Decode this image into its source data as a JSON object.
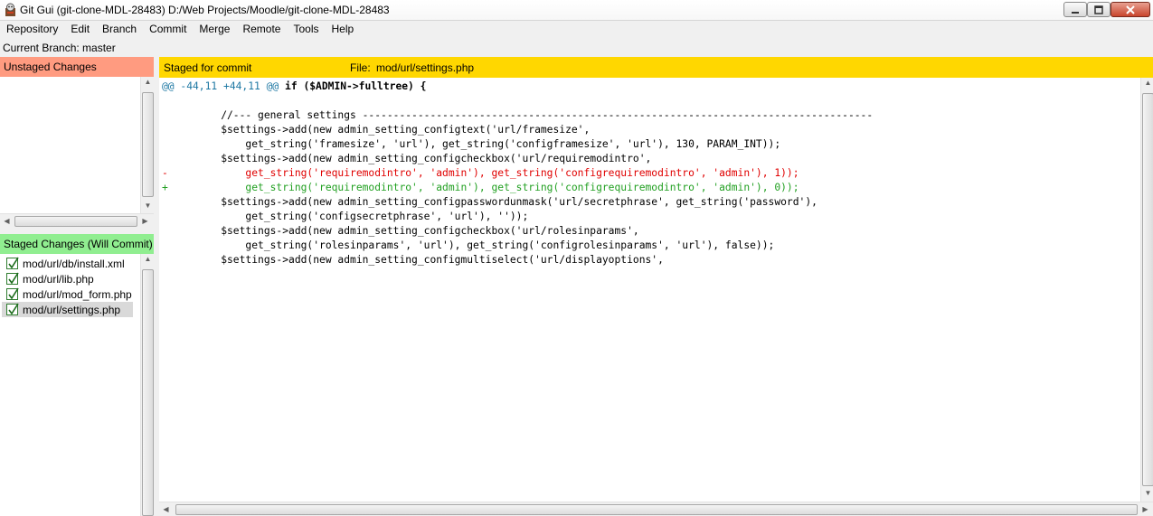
{
  "window": {
    "title": "Git Gui (git-clone-MDL-28483) D:/Web Projects/Moodle/git-clone-MDL-28483",
    "min_glyph": "▁",
    "max_glyph": "▢",
    "close_glyph": "✕"
  },
  "menu": {
    "items": [
      "Repository",
      "Edit",
      "Branch",
      "Commit",
      "Merge",
      "Remote",
      "Tools",
      "Help"
    ]
  },
  "branch": {
    "text": "Current Branch: master"
  },
  "unstaged": {
    "header": "Unstaged Changes",
    "header_color": "#ff9b80"
  },
  "staged": {
    "header": "Staged Changes (Will Commit)",
    "header_color": "#90ee90",
    "files": [
      "mod/url/db/install.xml",
      "mod/url/lib.php",
      "mod/url/mod_form.php",
      "mod/url/settings.php"
    ],
    "selected_index": 3
  },
  "diff": {
    "header_color": "#ffd700",
    "status": "Staged for commit",
    "file_label": "File:",
    "file_path": "mod/url/settings.php",
    "hunk_meta": "@@ -44,11 +44,11 @@",
    "hunk_context": " if ($ADMIN->fulltree) {",
    "lines": [
      {
        "prefix": " ",
        "text": "",
        "kind": "ctx"
      },
      {
        "prefix": " ",
        "text": "    //--- general settings -----------------------------------------------------------------------------------",
        "kind": "ctx"
      },
      {
        "prefix": " ",
        "text": "    $settings->add(new admin_setting_configtext('url/framesize',",
        "kind": "ctx"
      },
      {
        "prefix": " ",
        "text": "        get_string('framesize', 'url'), get_string('configframesize', 'url'), 130, PARAM_INT));",
        "kind": "ctx"
      },
      {
        "prefix": " ",
        "text": "    $settings->add(new admin_setting_configcheckbox('url/requiremodintro',",
        "kind": "ctx"
      },
      {
        "prefix": "-",
        "text": "        get_string('requiremodintro', 'admin'), get_string('configrequiremodintro', 'admin'), 1));",
        "kind": "del"
      },
      {
        "prefix": "+",
        "text": "        get_string('requiremodintro', 'admin'), get_string('configrequiremodintro', 'admin'), 0));",
        "kind": "add"
      },
      {
        "prefix": " ",
        "text": "    $settings->add(new admin_setting_configpasswordunmask('url/secretphrase', get_string('password'),",
        "kind": "ctx"
      },
      {
        "prefix": " ",
        "text": "        get_string('configsecretphrase', 'url'), ''));",
        "kind": "ctx"
      },
      {
        "prefix": " ",
        "text": "    $settings->add(new admin_setting_configcheckbox('url/rolesinparams',",
        "kind": "ctx"
      },
      {
        "prefix": " ",
        "text": "        get_string('rolesinparams', 'url'), get_string('configrolesinparams', 'url'), false));",
        "kind": "ctx"
      },
      {
        "prefix": " ",
        "text": "    $settings->add(new admin_setting_configmultiselect('url/displayoptions',",
        "kind": "ctx"
      }
    ]
  },
  "scroll": {
    "up": "▲",
    "down": "▼",
    "left": "◀",
    "right": "▶"
  }
}
